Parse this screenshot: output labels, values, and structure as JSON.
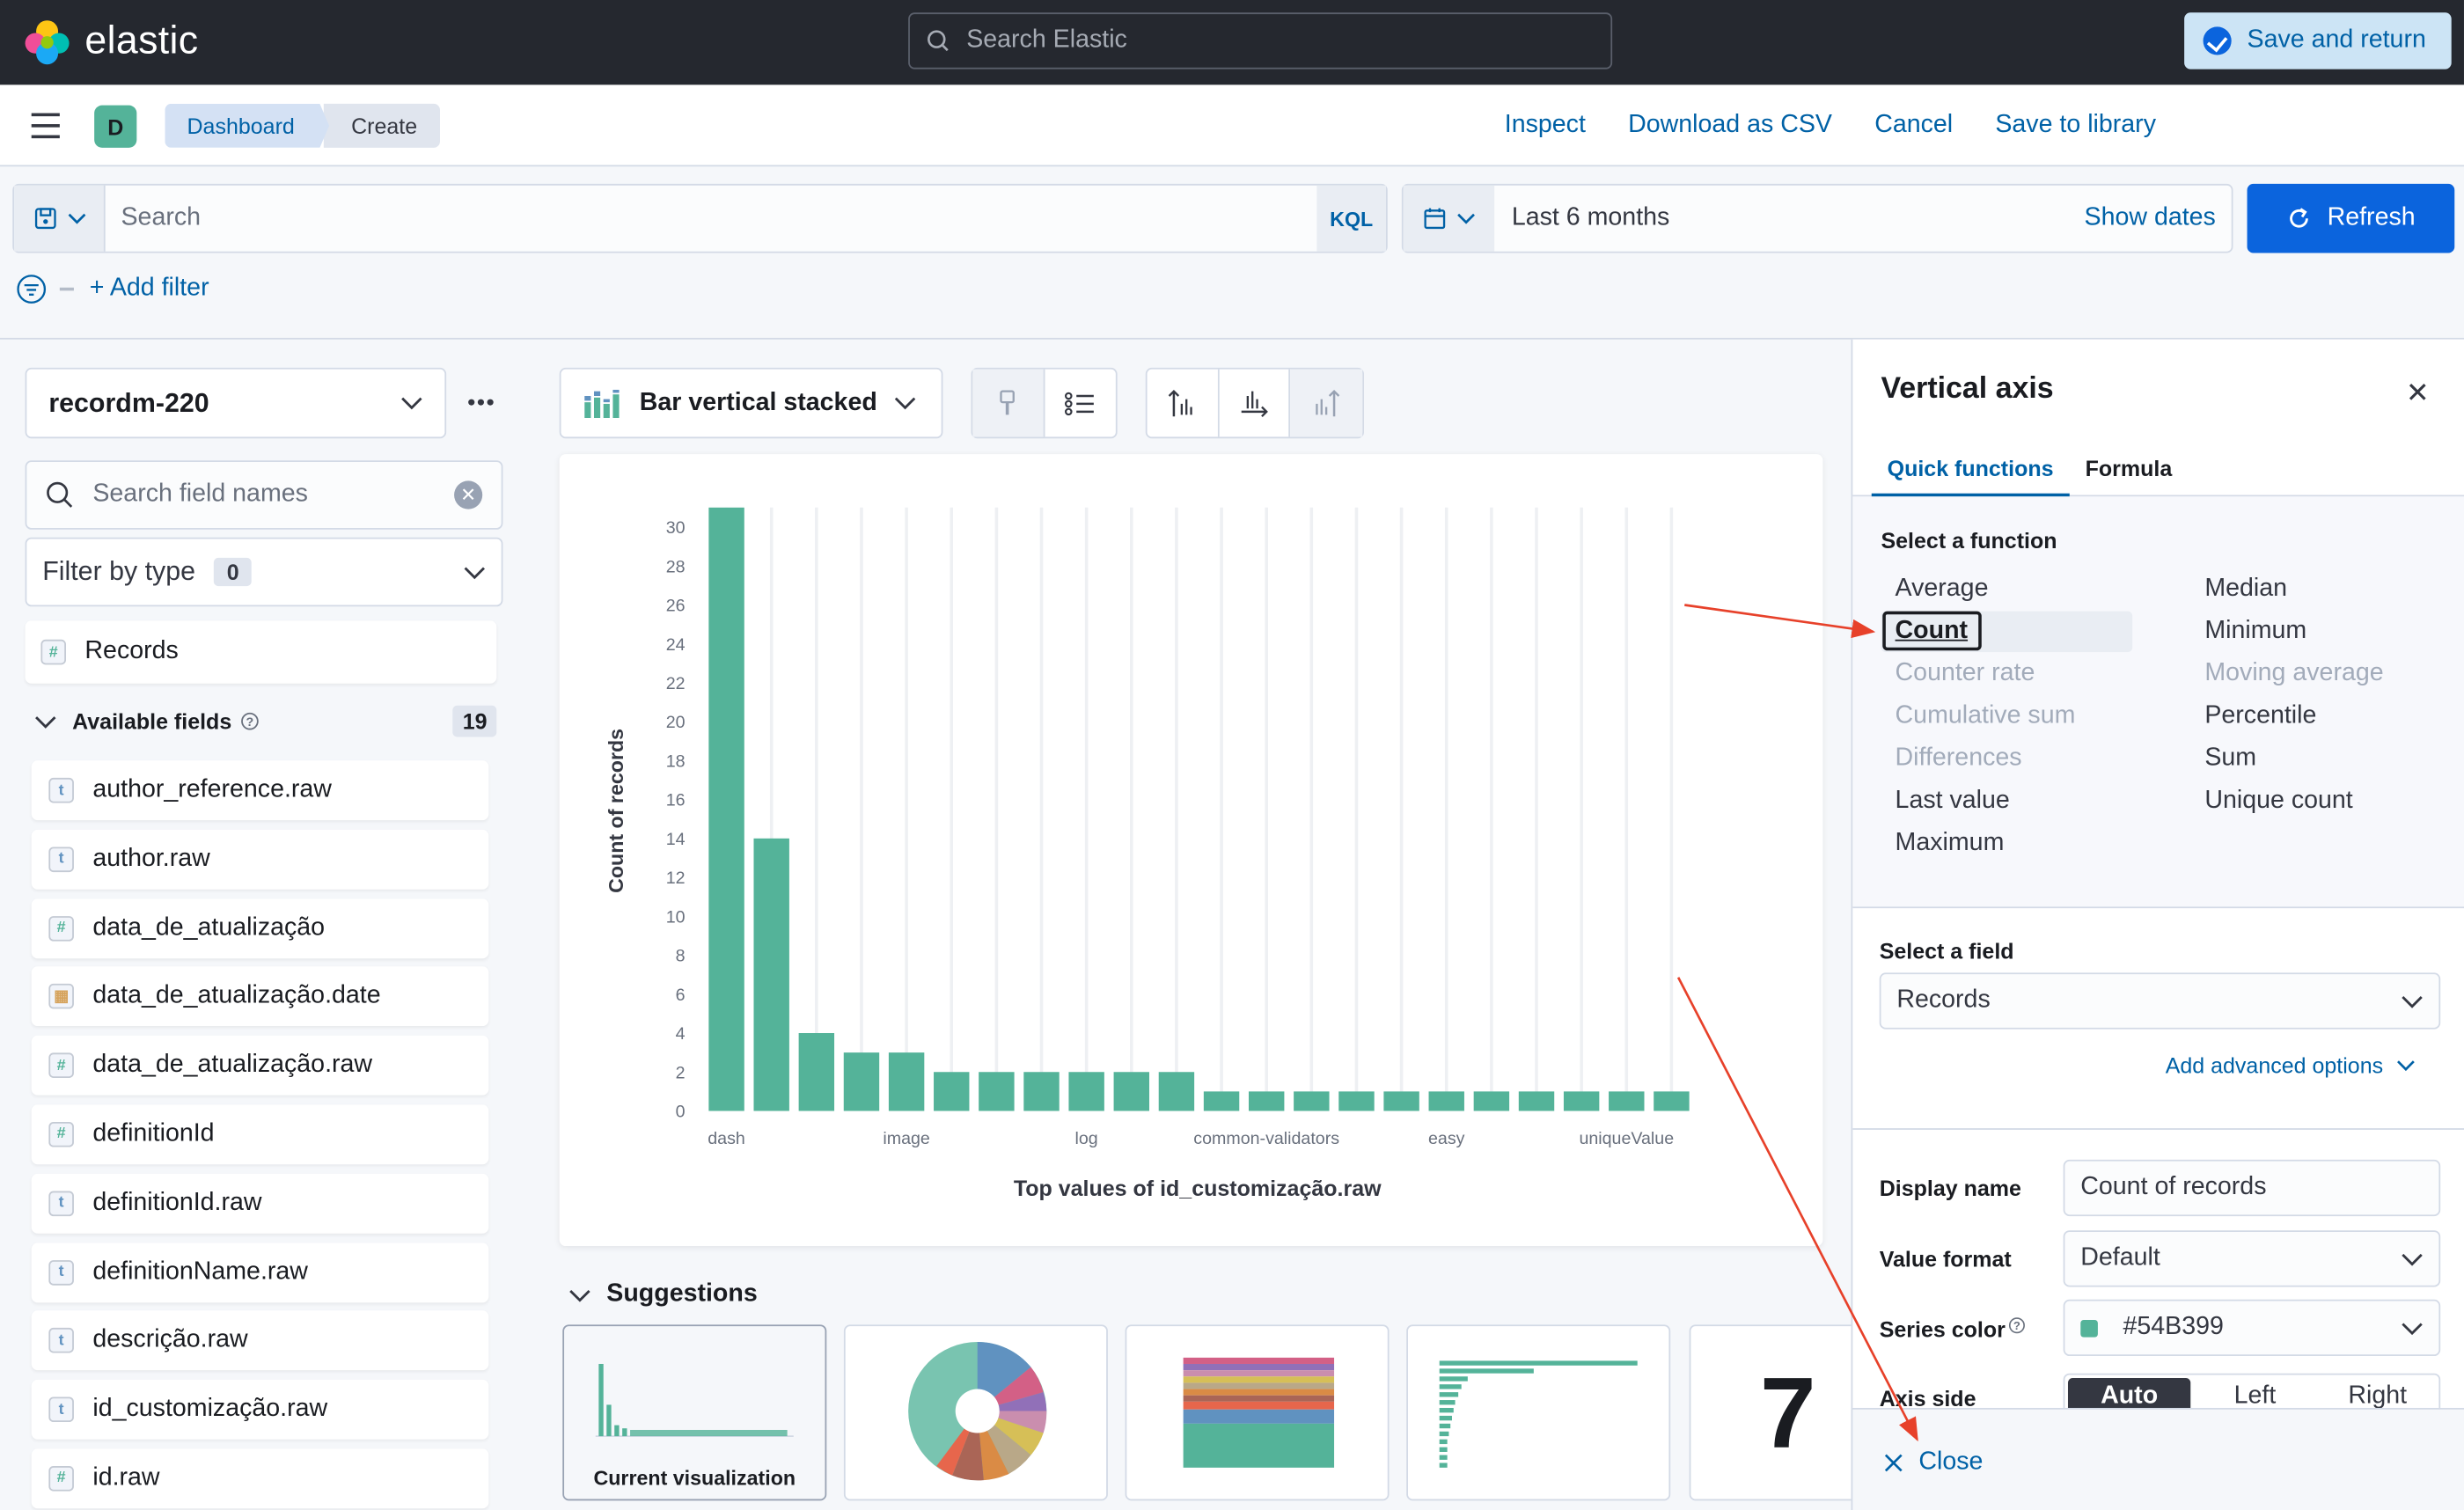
{
  "app": {
    "name": "elastic",
    "global_search_placeholder": "Search Elastic"
  },
  "breadcrumbs": {
    "avatar": "D",
    "items": [
      "Dashboard",
      "Create"
    ]
  },
  "header_actions": {
    "inspect": "Inspect",
    "download_csv": "Download as CSV",
    "cancel": "Cancel",
    "save_to_library": "Save to library",
    "save_and_return": "Save and return"
  },
  "query": {
    "placeholder": "Search",
    "language": "KQL",
    "time_range": "Last 6 months",
    "show_dates": "Show dates",
    "refresh": "Refresh",
    "add_filter": "+ Add filter"
  },
  "left_panel": {
    "index_pattern": "recordm-220",
    "search_placeholder": "Search field names",
    "filter_by_type": "Filter by type",
    "filter_count": "0",
    "records": "Records",
    "available_fields_label": "Available fields",
    "available_fields_count": "19",
    "fields": [
      {
        "name": "author_reference.raw",
        "type": "t"
      },
      {
        "name": "author.raw",
        "type": "t"
      },
      {
        "name": "data_de_atualização",
        "type": "#"
      },
      {
        "name": "data_de_atualização.date",
        "type": "date"
      },
      {
        "name": "data_de_atualização.raw",
        "type": "#"
      },
      {
        "name": "definitionId",
        "type": "#"
      },
      {
        "name": "definitionId.raw",
        "type": "t"
      },
      {
        "name": "definitionName.raw",
        "type": "t"
      },
      {
        "name": "descrição.raw",
        "type": "t"
      },
      {
        "name": "id_customização.raw",
        "type": "t"
      },
      {
        "name": "id.raw",
        "type": "#"
      }
    ]
  },
  "workspace": {
    "viz_type": "Bar vertical stacked",
    "suggestions_title": "Suggestions",
    "current_visualization": "Current visualization",
    "metric_suggestion": "7"
  },
  "chart_data": {
    "type": "bar",
    "ylabel": "Count of records",
    "xlabel": "Top values of id_customização.raw",
    "ylim": [
      0,
      30
    ],
    "yticks": [
      0,
      2,
      4,
      6,
      8,
      10,
      12,
      14,
      16,
      18,
      20,
      22,
      24,
      26,
      28,
      30
    ],
    "categories": [
      "dash",
      "",
      "",
      "",
      "image",
      "",
      "",
      "",
      "log",
      "",
      "",
      "",
      "common-validators",
      "",
      "",
      "",
      "easy",
      "",
      "",
      "",
      "uniqueValue",
      ""
    ],
    "values": [
      31,
      14,
      4,
      3,
      3,
      2,
      2,
      2,
      2,
      2,
      2,
      1,
      1,
      1,
      1,
      1,
      1,
      1,
      1,
      1,
      1,
      1
    ],
    "color": "#54B399",
    "grid": "vertical"
  },
  "flyout": {
    "title": "Vertical axis",
    "tabs": [
      "Quick functions",
      "Formula"
    ],
    "select_function_label": "Select a function",
    "functions_left": [
      {
        "label": "Average",
        "enabled": true
      },
      {
        "label": "Count",
        "enabled": true,
        "selected": true
      },
      {
        "label": "Counter rate",
        "enabled": false
      },
      {
        "label": "Cumulative sum",
        "enabled": false
      },
      {
        "label": "Differences",
        "enabled": false
      },
      {
        "label": "Last value",
        "enabled": true
      },
      {
        "label": "Maximum",
        "enabled": true
      }
    ],
    "functions_right": [
      {
        "label": "Median",
        "enabled": true
      },
      {
        "label": "Minimum",
        "enabled": true
      },
      {
        "label": "Moving average",
        "enabled": false
      },
      {
        "label": "Percentile",
        "enabled": true
      },
      {
        "label": "Sum",
        "enabled": true
      },
      {
        "label": "Unique count",
        "enabled": true
      }
    ],
    "select_field_label": "Select a field",
    "field_value": "Records",
    "advanced_options": "Add advanced options",
    "display_name_label": "Display name",
    "display_name_value": "Count of records",
    "value_format_label": "Value format",
    "value_format_value": "Default",
    "series_color_label": "Series color",
    "series_color_value": "#54B399",
    "axis_side_label": "Axis side",
    "axis_side_options": [
      "Auto",
      "Left",
      "Right"
    ],
    "close": "Close"
  },
  "colors": {
    "accent": "#0B64DD",
    "link": "#0061A6",
    "series": "#54B399",
    "annotation_arrow": "#E7412A"
  }
}
